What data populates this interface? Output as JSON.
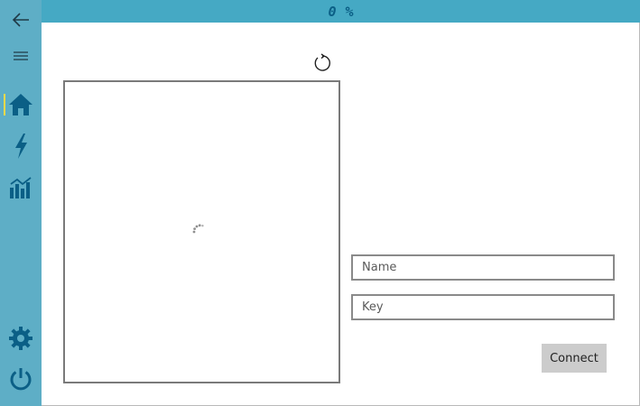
{
  "status_bar": {
    "progress_value": "0",
    "progress_unit": "%"
  },
  "sidebar": {
    "items": [
      {
        "icon": "back-arrow-icon"
      },
      {
        "icon": "hamburger-menu-icon"
      },
      {
        "icon": "home-icon",
        "active": true
      },
      {
        "icon": "lightning-bolt-icon"
      },
      {
        "icon": "bar-chart-icon"
      },
      {
        "icon": "gear-icon"
      },
      {
        "icon": "power-icon"
      }
    ]
  },
  "form": {
    "name_placeholder": "Name",
    "key_placeholder": "Key",
    "connect_label": "Connect"
  },
  "colors": {
    "sidebar": "#5eaec6",
    "status_bar": "#45a9c4",
    "icon_blue": "#0b5f86",
    "active_indicator": "#f3d94b"
  }
}
